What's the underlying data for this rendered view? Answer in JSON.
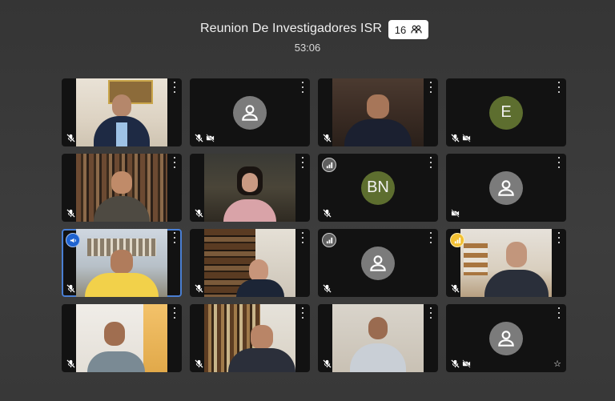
{
  "meeting": {
    "title": "Reunion De Investigadores ISR",
    "participant_count": "16",
    "elapsed": "53:06"
  },
  "colors": {
    "background": "#3a3a3a",
    "tile": "#121212",
    "avatar_gray": "#7b7b7b",
    "avatar_green": "#5d6e2f",
    "active_speaker": "#4a7fd3"
  },
  "tiles": [
    {
      "kind": "video",
      "mic": "muted",
      "cam": "on"
    },
    {
      "kind": "avatar",
      "mic": "muted",
      "cam": "off"
    },
    {
      "kind": "video",
      "mic": "muted",
      "cam": "on"
    },
    {
      "kind": "initials",
      "initials": "E",
      "mic": "muted",
      "cam": "off"
    },
    {
      "kind": "video",
      "mic": "muted",
      "cam": "on"
    },
    {
      "kind": "video",
      "mic": "muted",
      "cam": "on"
    },
    {
      "kind": "initials",
      "initials": "BN",
      "mic": "muted",
      "cam": "on",
      "badge": "signal"
    },
    {
      "kind": "avatar",
      "mic": "on",
      "cam": "off"
    },
    {
      "kind": "video",
      "mic": "muted",
      "cam": "on",
      "badge": "speaking",
      "active": true
    },
    {
      "kind": "video",
      "mic": "muted",
      "cam": "on"
    },
    {
      "kind": "avatar",
      "mic": "muted",
      "cam": "on",
      "badge": "signal"
    },
    {
      "kind": "video",
      "mic": "muted",
      "cam": "on",
      "badge": "signal-yellow"
    },
    {
      "kind": "video",
      "mic": "muted",
      "cam": "on"
    },
    {
      "kind": "video",
      "mic": "muted",
      "cam": "on"
    },
    {
      "kind": "video",
      "mic": "muted",
      "cam": "on"
    },
    {
      "kind": "avatar",
      "mic": "muted",
      "cam": "off",
      "pinned": true
    }
  ]
}
